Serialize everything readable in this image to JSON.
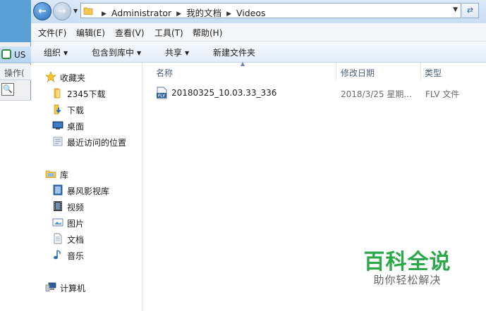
{
  "background_window": {
    "title": "US",
    "menu_label": "操作(",
    "tool_glyph": "🔍"
  },
  "address_bar": {
    "crumbs": [
      "Administrator",
      "我的文档",
      "Videos"
    ]
  },
  "menu": {
    "file": "文件(F)",
    "edit": "编辑(E)",
    "view": "查看(V)",
    "tools": "工具(T)",
    "help": "帮助(H)"
  },
  "toolbar": {
    "organize": "组织",
    "include_in_library": "包含到库中",
    "share": "共享",
    "new_folder": "新建文件夹"
  },
  "nav_pane": {
    "favorites": "收藏夹",
    "favorites_items": [
      "2345下载",
      "下载",
      "桌面",
      "最近访问的位置"
    ],
    "libraries": "库",
    "library_items": [
      "暴风影视库",
      "视频",
      "图片",
      "文档",
      "音乐"
    ],
    "computer": "计算机"
  },
  "columns": {
    "name": "名称",
    "date": "修改日期",
    "type": "类型"
  },
  "files": [
    {
      "name": "20180325_10.03.33_336",
      "date": "2018/3/25 星期...",
      "type": "FLV 文件",
      "icon": "flv-file-icon"
    }
  ],
  "watermark": {
    "title": "百科全说",
    "subtitle": "助你轻松解决"
  },
  "colors": {
    "accent": "#2aa84a",
    "toolbar_bg": "#e3ecf7",
    "header_text": "#4c607a"
  }
}
